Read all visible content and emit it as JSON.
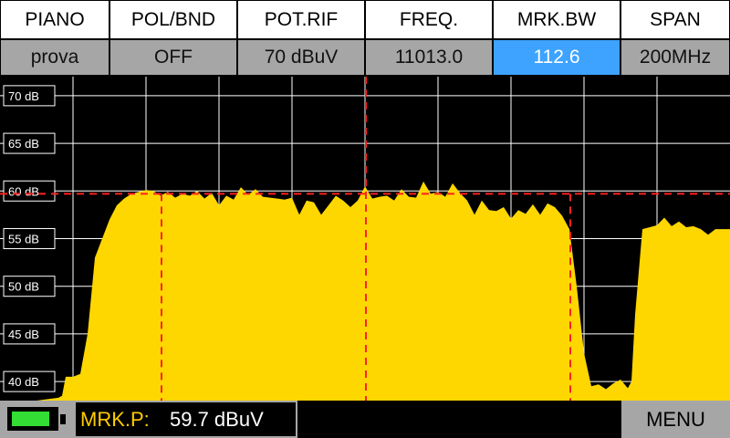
{
  "header": {
    "titles": [
      "PIANO",
      "POL/BND",
      "POT.RIF",
      "FREQ.",
      "MRK.BW",
      "SPAN"
    ],
    "values": [
      "prova",
      "OFF",
      "70 dBuV",
      "11013.0",
      "112.6",
      "200MHz"
    ],
    "active_index": 4
  },
  "chart_data": {
    "type": "area",
    "y_tick_labels": [
      "70 dB",
      "65 dB",
      "60 dB",
      "55 dB",
      "50 dB",
      "45 dB",
      "40 dB"
    ],
    "ylim": [
      38,
      72
    ],
    "grid": true,
    "fill_color": "#ffd700",
    "marker_color": "#ff2020",
    "marker_level_db": 59.7,
    "spectrum": [
      [
        0,
        38
      ],
      [
        5,
        38
      ],
      [
        8,
        38.3
      ],
      [
        8.5,
        38.5
      ],
      [
        9,
        40.5
      ],
      [
        10,
        40.5
      ],
      [
        11,
        40.8
      ],
      [
        12,
        45
      ],
      [
        12.5,
        49
      ],
      [
        13,
        53
      ],
      [
        14,
        55
      ],
      [
        15,
        57
      ],
      [
        16,
        58.5
      ],
      [
        17,
        59.2
      ],
      [
        18,
        59.7
      ],
      [
        20,
        60.1
      ],
      [
        21,
        60
      ],
      [
        22,
        59.5
      ],
      [
        23,
        59.9
      ],
      [
        24,
        59.3
      ],
      [
        25,
        59.7
      ],
      [
        26,
        59.5
      ],
      [
        27,
        60
      ],
      [
        28,
        59.2
      ],
      [
        29,
        59.8
      ],
      [
        30,
        58.5
      ],
      [
        31,
        59.5
      ],
      [
        32,
        59.1
      ],
      [
        33,
        60.4
      ],
      [
        34,
        59.6
      ],
      [
        35,
        60.2
      ],
      [
        36,
        59.4
      ],
      [
        37,
        59.3
      ],
      [
        38,
        59.2
      ],
      [
        39,
        59.1
      ],
      [
        40,
        59.3
      ],
      [
        41,
        57.5
      ],
      [
        42,
        59
      ],
      [
        43,
        58.8
      ],
      [
        44,
        57.5
      ],
      [
        45,
        58.5
      ],
      [
        46,
        59.5
      ],
      [
        47,
        59
      ],
      [
        48,
        58.3
      ],
      [
        49,
        59
      ],
      [
        50,
        60.5
      ],
      [
        51,
        59.2
      ],
      [
        52,
        59.4
      ],
      [
        53,
        59.5
      ],
      [
        54,
        59
      ],
      [
        55,
        60.2
      ],
      [
        56,
        59.4
      ],
      [
        57,
        59.3
      ],
      [
        58,
        61
      ],
      [
        59,
        59.7
      ],
      [
        60,
        59.9
      ],
      [
        61,
        59.4
      ],
      [
        62,
        60.8
      ],
      [
        63,
        59.8
      ],
      [
        64,
        59
      ],
      [
        65,
        57.5
      ],
      [
        66,
        59
      ],
      [
        67,
        58
      ],
      [
        68,
        57.9
      ],
      [
        69,
        58.3
      ],
      [
        70,
        57.1
      ],
      [
        71,
        58
      ],
      [
        72,
        57.6
      ],
      [
        73,
        58.6
      ],
      [
        74,
        57.5
      ],
      [
        75,
        58.7
      ],
      [
        76,
        58.3
      ],
      [
        77,
        57.4
      ],
      [
        78,
        56
      ],
      [
        79,
        50
      ],
      [
        80,
        43
      ],
      [
        81,
        39.5
      ],
      [
        82,
        39.7
      ],
      [
        83,
        39.2
      ],
      [
        84,
        39.8
      ],
      [
        85,
        40.2
      ],
      [
        86,
        39.3
      ],
      [
        86.5,
        40
      ],
      [
        87,
        47
      ],
      [
        88,
        56
      ],
      [
        89,
        56.2
      ],
      [
        90,
        56.4
      ],
      [
        91,
        57.2
      ],
      [
        92,
        56.3
      ],
      [
        93,
        56.8
      ],
      [
        94,
        56.2
      ],
      [
        95,
        56.3
      ],
      [
        96,
        56
      ],
      [
        97,
        55.4
      ],
      [
        98,
        56
      ],
      [
        100,
        56
      ]
    ]
  },
  "footer": {
    "battery_level": 0.85,
    "mrk_p_label": "MRK.P:",
    "mrk_p_value": "59.7 dBuV",
    "menu_label": "MENU"
  }
}
